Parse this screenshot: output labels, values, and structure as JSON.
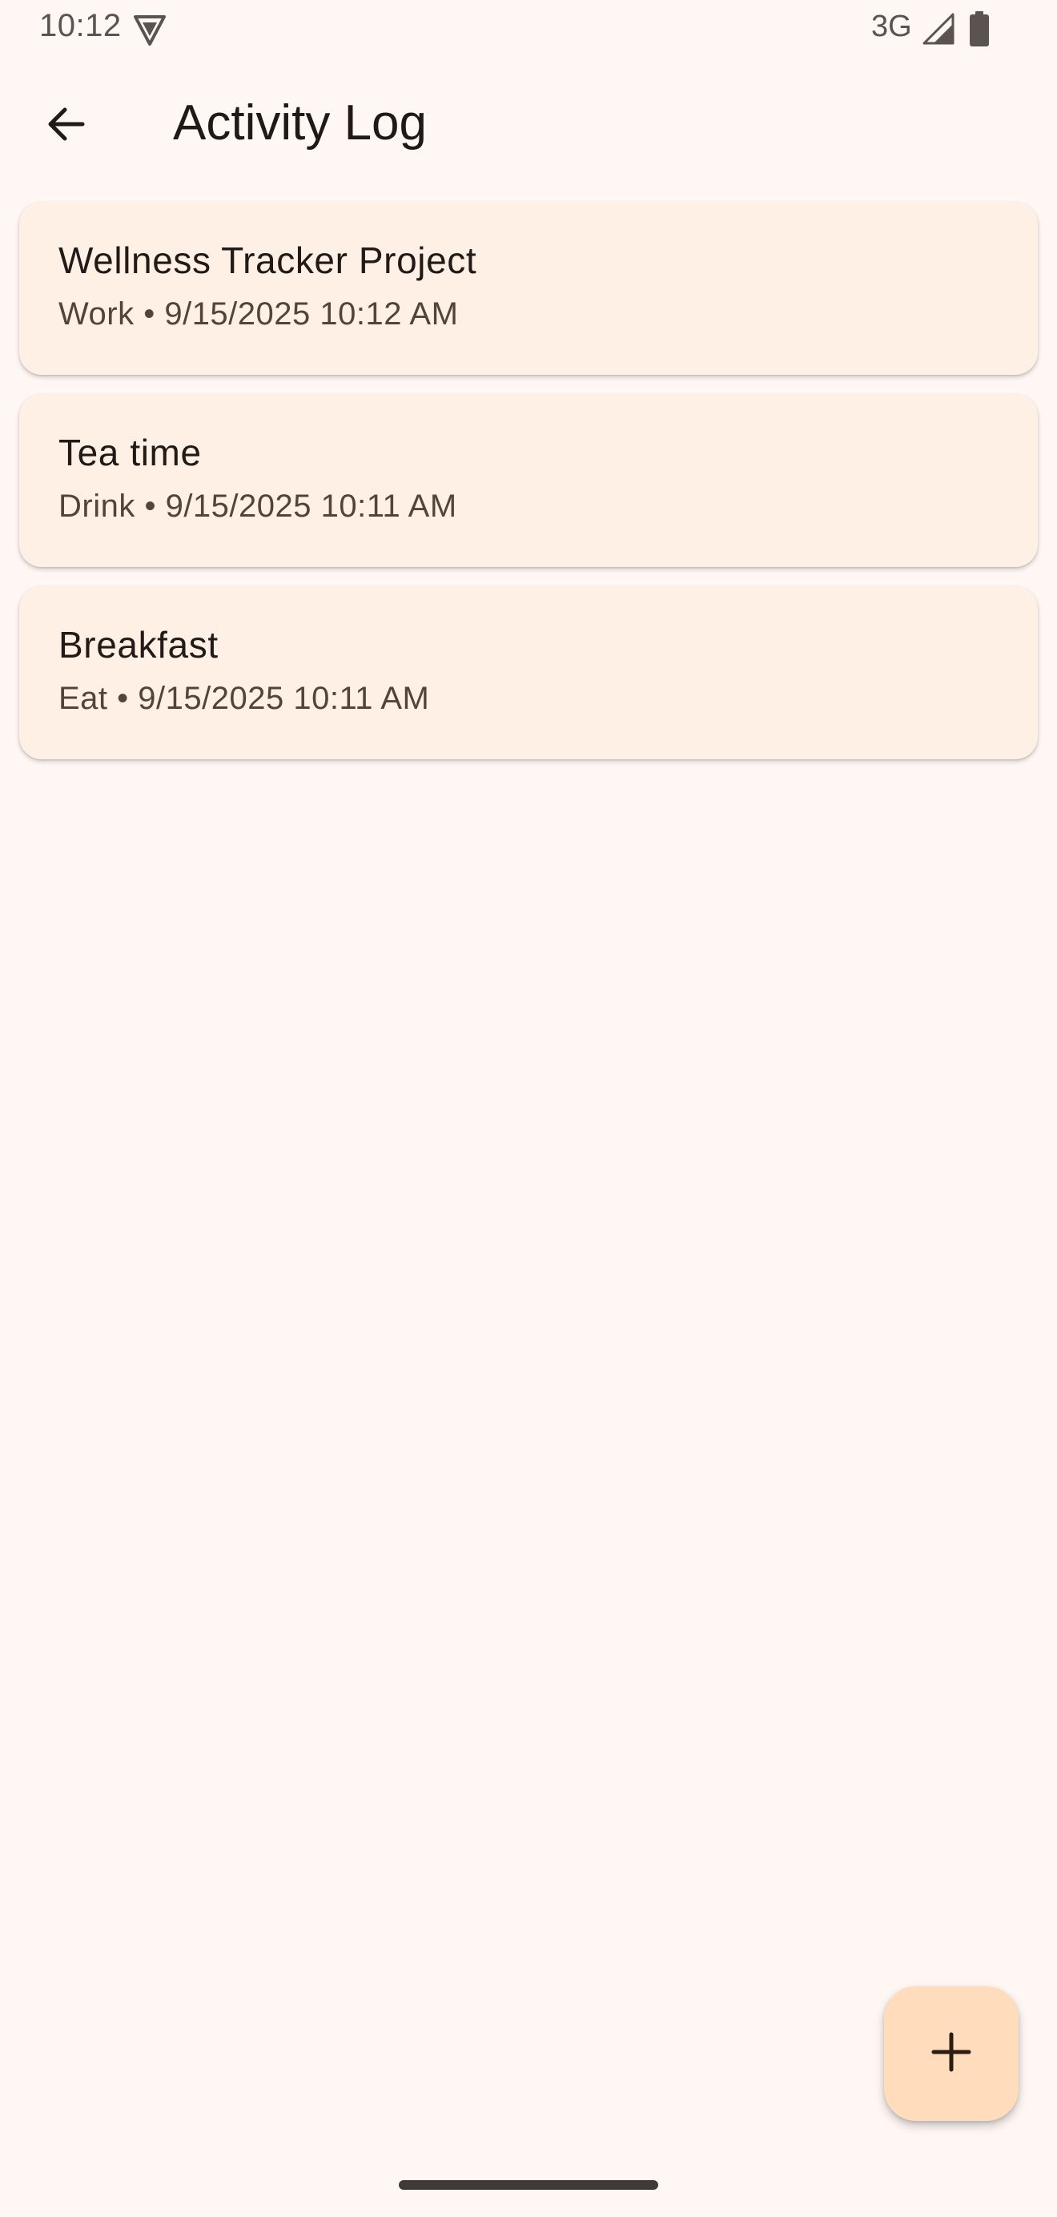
{
  "status_bar": {
    "time": "10:12",
    "network": "3G",
    "left_icon": "shield-app-icon",
    "signal_icon": "cell-signal-icon",
    "battery_icon": "battery-icon"
  },
  "app_bar": {
    "back_icon": "arrow-back-icon",
    "title": "Activity Log"
  },
  "activities": [
    {
      "title": "Wellness Tracker Project",
      "subtitle": "Work • 9/15/2025 10:12 AM"
    },
    {
      "title": "Tea time",
      "subtitle": "Drink • 9/15/2025 10:11 AM"
    },
    {
      "title": "Breakfast",
      "subtitle": "Eat • 9/15/2025 10:11 AM"
    }
  ],
  "fab": {
    "icon": "plus-icon"
  },
  "colors": {
    "background": "#fff7f4",
    "card": "#fff0e6",
    "fab": "#ffdcbc",
    "text_primary": "#211a16",
    "text_secondary": "#52443b"
  }
}
